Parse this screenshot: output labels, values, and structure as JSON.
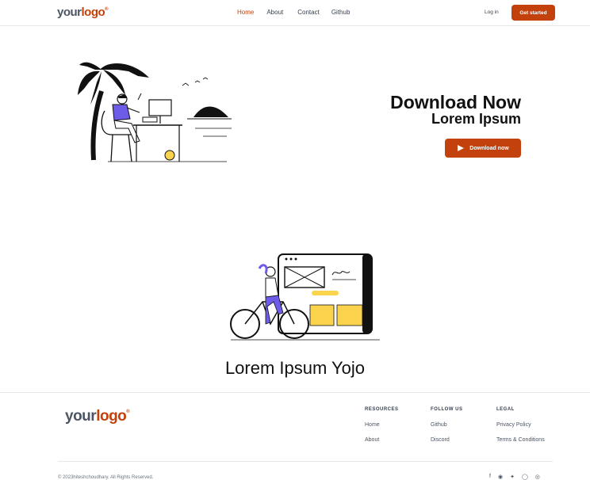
{
  "nav": {
    "logo_a": "your",
    "logo_b": "logo",
    "logo_mark": "®",
    "links": [
      "Home",
      "About",
      "Contact",
      "Github"
    ],
    "login": "Log in",
    "get_started": "Get started",
    "active_color": "#c2410c"
  },
  "hero": {
    "title": "Download Now",
    "subtitle": "Lorem Ipsum",
    "download_btn": "Download now",
    "download_icon": "play-store-icon"
  },
  "section2": {
    "title": "Lorem Ipsum Yojo"
  },
  "footer": {
    "logo_a": "your",
    "logo_b": "logo",
    "logo_mark": "®",
    "cols": [
      {
        "heading": "RESOURCES",
        "items": [
          "Home",
          "About"
        ]
      },
      {
        "heading": "FOLLOW US",
        "items": [
          "Github",
          "Discord"
        ]
      },
      {
        "heading": "LEGAL",
        "items": [
          "Privacy Policy",
          "Terms & Conditions"
        ]
      }
    ],
    "copyright": "© 2023hiteshchoudhary. All Rights Reserved.",
    "social_icons": [
      "facebook-icon",
      "discord-icon",
      "twitter-icon",
      "github-icon",
      "dribbble-icon"
    ]
  },
  "colors": {
    "brand": "#c2410c",
    "accent_purple": "#6d5ce8",
    "accent_yellow": "#fcd34d"
  }
}
